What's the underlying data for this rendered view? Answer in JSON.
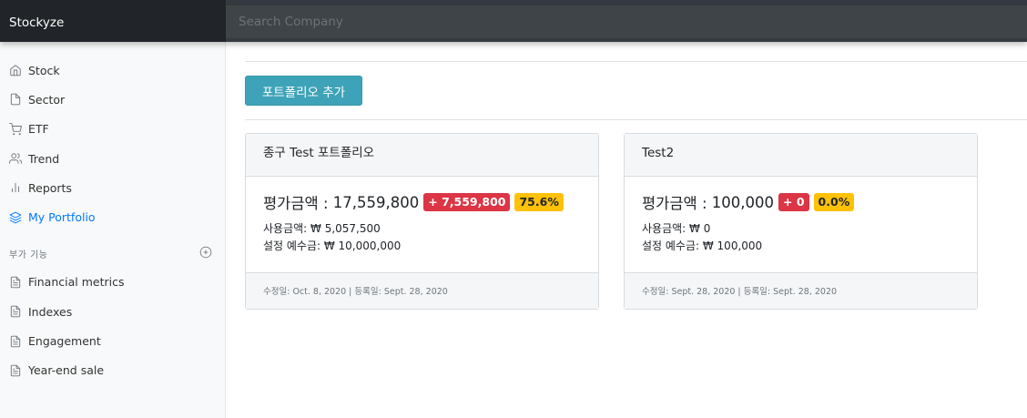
{
  "navbar": {
    "brand": "Stockyze",
    "search_placeholder": "Search Company"
  },
  "sidebar": {
    "menu": [
      {
        "label": "Stock",
        "icon": "home-icon"
      },
      {
        "label": "Sector",
        "icon": "file-icon"
      },
      {
        "label": "ETF",
        "icon": "cart-icon"
      },
      {
        "label": "Trend",
        "icon": "users-icon"
      },
      {
        "label": "Reports",
        "icon": "bar-chart-icon"
      },
      {
        "label": "My Portfolio",
        "icon": "layers-icon",
        "active": true
      }
    ],
    "section_title": "부가 기능",
    "section_items": [
      {
        "label": "Financial metrics",
        "icon": "file-text-icon"
      },
      {
        "label": "Indexes",
        "icon": "file-text-icon"
      },
      {
        "label": "Engagement",
        "icon": "file-text-icon"
      },
      {
        "label": "Year-end sale",
        "icon": "file-text-icon"
      }
    ]
  },
  "main": {
    "add_button_label": "포트폴리오 추가",
    "portfolios": [
      {
        "title": "종구 Test 포트폴리오",
        "value_label": "평가금액 :",
        "value": "17,559,800",
        "change": "+ 7,559,800",
        "percent": "75.6%",
        "used": "사용금액: ₩ 5,057,500",
        "deposit": "설정 예수금: ₩ 10,000,000",
        "dates": "수정일: Oct. 8, 2020 | 등록일: Sept. 28, 2020"
      },
      {
        "title": "Test2",
        "value_label": "평가금액 :",
        "value": "100,000",
        "change": "+ 0",
        "percent": "0.0%",
        "used": "사용금액: ₩ 0",
        "deposit": "설정 예수금: ₩ 100,000",
        "dates": "수정일: Sept. 28, 2020 | 등록일: Sept. 28, 2020"
      }
    ]
  },
  "colors": {
    "accent": "#007bff",
    "info_button": "#3ea3b8",
    "danger": "#dc3545",
    "warning": "#ffc107"
  }
}
